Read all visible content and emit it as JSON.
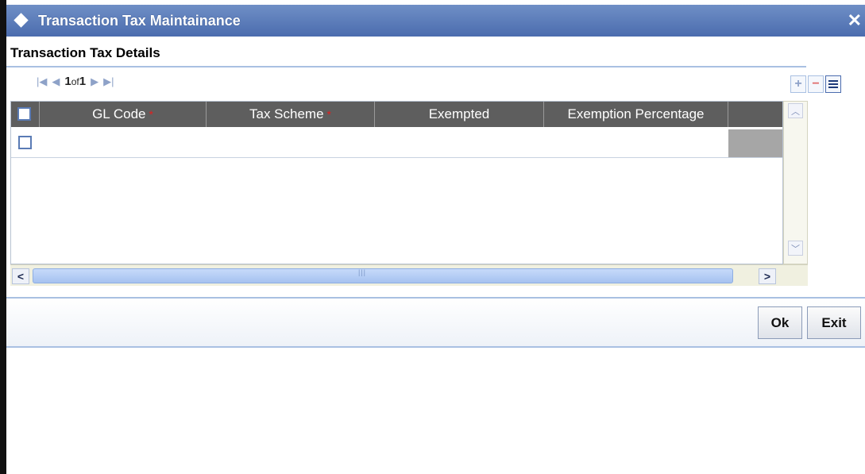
{
  "window": {
    "title": "Transaction Tax Maintainance",
    "close_glyph": "✕"
  },
  "section": {
    "title": "Transaction Tax Details"
  },
  "pager": {
    "current": "1",
    "of_label": "of",
    "total": "1"
  },
  "grid": {
    "columns": [
      {
        "label": "GL Code",
        "required": true
      },
      {
        "label": "Tax Scheme",
        "required": true
      },
      {
        "label": "Exempted",
        "required": false
      },
      {
        "label": "Exemption Percentage",
        "required": false
      }
    ],
    "required_marker": "*",
    "rows": [
      {
        "gl_code": "",
        "tax_scheme": "",
        "exempted": "",
        "exemption_percentage": ""
      }
    ]
  },
  "toolbar": {
    "add_glyph": "+",
    "delete_glyph": "−",
    "icons": [
      "add-row-icon",
      "delete-row-icon",
      "single-record-view-icon"
    ]
  },
  "footer": {
    "ok_label": "Ok",
    "exit_label": "Exit"
  },
  "colors": {
    "title_bar": "#4b6cae",
    "header_bg": "#5e5e5e",
    "required": "#e02020",
    "accent_border": "#a9c0e2"
  }
}
